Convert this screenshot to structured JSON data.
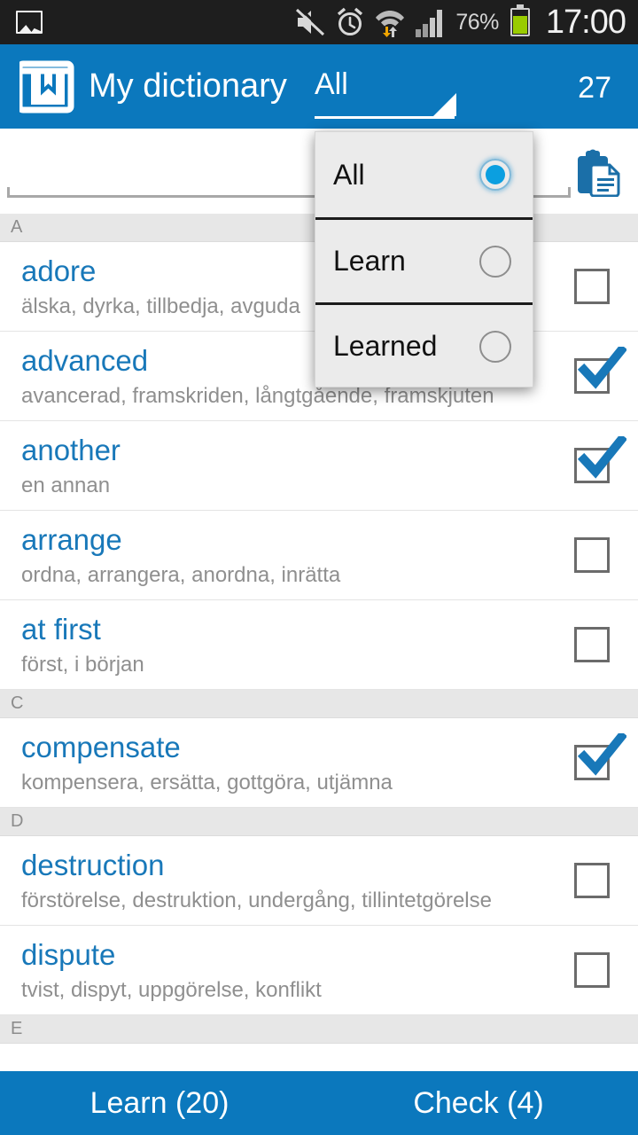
{
  "statusbar": {
    "icons": [
      "gallery-icon",
      "mute-icon",
      "alarm-icon",
      "wifi-transfer-icon",
      "signal-icon"
    ],
    "battery_percent": "76%",
    "time": "17:00"
  },
  "appbar": {
    "logo_icon": "book-bookmark-icon",
    "title": "My dictionary",
    "filter_value": "All",
    "dropdown_icon": "spinner-triangle-icon",
    "count": "27",
    "accent_color": "#0b78bd"
  },
  "search": {
    "value": "",
    "placeholder": "",
    "paste_icon": "clipboard-paste-icon"
  },
  "dropdown": {
    "visible": true,
    "options": [
      {
        "label": "All",
        "selected": true
      },
      {
        "label": "Learn",
        "selected": false
      },
      {
        "label": "Learned",
        "selected": false
      }
    ]
  },
  "list": {
    "sections": [
      {
        "letter": "A",
        "entries": [
          {
            "word": "adore",
            "translation": "älska, dyrka, tillbedja, avguda",
            "checked": false
          },
          {
            "word": "advanced",
            "translation": "avancerad, framskriden, långtgående, framskjuten",
            "checked": true
          },
          {
            "word": "another",
            "translation": "en annan",
            "checked": true
          },
          {
            "word": "arrange",
            "translation": "ordna, arrangera, anordna, inrätta",
            "checked": false
          },
          {
            "word": "at first",
            "translation": "först, i början",
            "checked": false
          }
        ]
      },
      {
        "letter": "C",
        "entries": [
          {
            "word": "compensate",
            "translation": "kompensera, ersätta, gottgöra, utjämna",
            "checked": true
          }
        ]
      },
      {
        "letter": "D",
        "entries": [
          {
            "word": "destruction",
            "translation": "förstörelse, destruktion, undergång, tillintetgörelse",
            "checked": false
          },
          {
            "word": "dispute",
            "translation": "tvist, dispyt, uppgörelse, konflikt",
            "checked": false
          }
        ]
      },
      {
        "letter": "E",
        "entries": []
      }
    ]
  },
  "bottombar": {
    "learn_label": "Learn (20)",
    "check_label": "Check (4)"
  }
}
